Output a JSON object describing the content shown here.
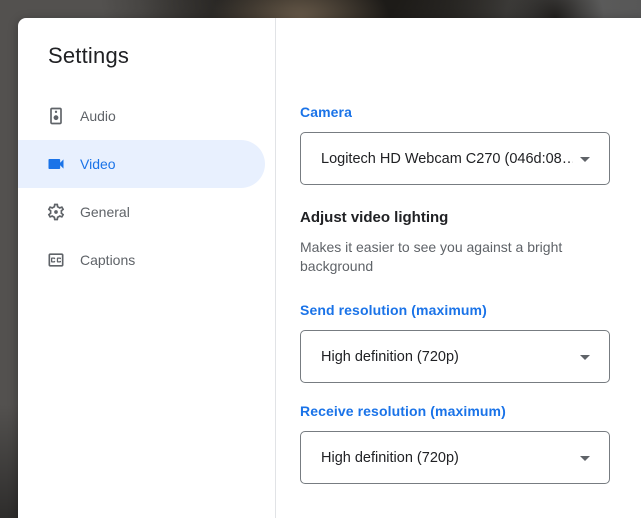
{
  "dialog": {
    "title": "Settings",
    "sidebar": {
      "items": [
        {
          "label": "Audio",
          "icon": "speaker-icon",
          "selected": false
        },
        {
          "label": "Video",
          "icon": "videocam-icon",
          "selected": true
        },
        {
          "label": "General",
          "icon": "gear-icon",
          "selected": false
        },
        {
          "label": "Captions",
          "icon": "captions-icon",
          "selected": false
        }
      ]
    },
    "content": {
      "camera": {
        "label": "Camera",
        "value": "Logitech HD Webcam C270 (046d:08…"
      },
      "lighting": {
        "title": "Adjust video lighting",
        "description": "Makes it easier to see you against a bright background"
      },
      "send_resolution": {
        "label": "Send resolution (maximum)",
        "value": "High definition (720p)"
      },
      "receive_resolution": {
        "label": "Receive resolution (maximum)",
        "value": "High definition (720p)"
      }
    }
  },
  "colors": {
    "accent_blue": "#1a73e8",
    "selected_item_bg": "#e8f0fe",
    "text_dark": "#202124",
    "text_gray": "#5f6368",
    "select_border": "#777c81",
    "dialog_bg": "#ffffff"
  }
}
